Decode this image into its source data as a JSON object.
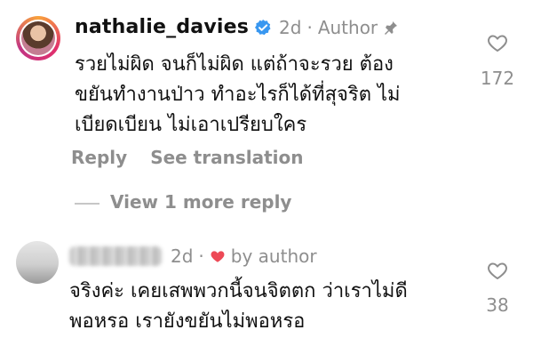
{
  "comment1": {
    "username": "nathalie_davies",
    "time": "2d",
    "separator": "·",
    "author_label": "Author",
    "text_lines": [
      "รวยไม่ผิด จนก็ไม่ผิด แต่ถ้าจะรวย ต้อง",
      "ขยันทำงานป่าว ทำอะไรก็ได้ที่สุจริต ไม่",
      "เบียดเบียน ไม่เอาเปรียบใคร"
    ],
    "reply_label": "Reply",
    "translate_label": "See translation",
    "like_count": "172"
  },
  "view_more": "View 1 more reply",
  "comment2": {
    "time": "2d",
    "separator": "·",
    "by_author": "by author",
    "text_lines": [
      "จริงค่ะ เคยเสพพวกนี้จนจิตตก ว่าเราไม่ดี",
      "พอหรอ เรายังขยันไม่พอหรอ"
    ],
    "like_count": "38"
  },
  "colors": {
    "verified": "#3897f0",
    "heart_red": "#ed4956",
    "muted": "#8e8e8e"
  }
}
